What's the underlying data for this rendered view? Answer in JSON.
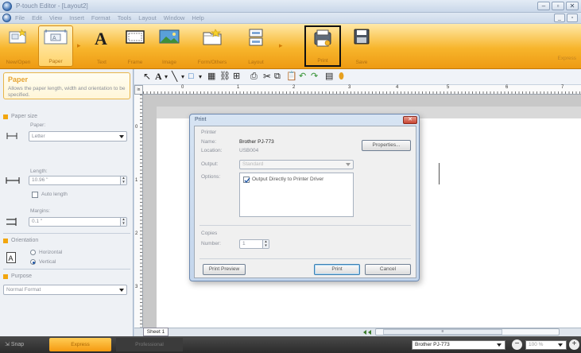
{
  "window": {
    "title": "P-touch Editor - [Layout2]",
    "controls": {
      "minimize": "–",
      "restore": "▫",
      "close": "✕"
    }
  },
  "menu": {
    "items": [
      "File",
      "Edit",
      "View",
      "Insert",
      "Format",
      "Tools",
      "Layout",
      "Window",
      "Help"
    ],
    "mdi_controls": {
      "minimize": "_",
      "restore": "▫"
    }
  },
  "ribbon": {
    "buttons": [
      {
        "label": "New/Open"
      },
      {
        "label": "Paper"
      },
      {
        "label": "Text"
      },
      {
        "label": "Frame"
      },
      {
        "label": "Image"
      },
      {
        "label": "Form/Others"
      },
      {
        "label": "Layout"
      },
      {
        "label": "Print"
      },
      {
        "label": "Save"
      }
    ],
    "right_label": "Express"
  },
  "left_panel": {
    "help_title": "Paper",
    "help_desc": "Allows the paper length, width and orientation to be specified.",
    "paper_size_title": "Paper size",
    "paper_label": "Paper:",
    "paper_value": "Letter",
    "length_label": "Length:",
    "length_value": "10.96 \"",
    "auto_length_label": "Auto length",
    "margins_label": "Margins:",
    "margins_value": "0.1 \"",
    "orientation_title": "Orientation",
    "horizontal_label": "Horizontal",
    "vertical_label": "Vertical",
    "purpose_title": "Purpose",
    "purpose_value": "Normal Format"
  },
  "ruler": {
    "unit": "in",
    "h_ticks": [
      "0",
      "1",
      "2",
      "3",
      "4",
      "5",
      "6",
      "7"
    ],
    "v_ticks": [
      "0",
      "1",
      "2",
      "3"
    ]
  },
  "dialog": {
    "title": "Print",
    "printer_group": "Printer",
    "name_label": "Name:",
    "name_value": "Brother PJ-773",
    "location_label": "Location:",
    "location_value": "USB004",
    "properties_button": "Properties...",
    "output_label": "Output:",
    "output_value": "Standard",
    "options_label": "Options:",
    "option_direct": "Output Directly to Printer Driver",
    "copies_group": "Copies",
    "number_label": "Number:",
    "number_value": "1",
    "print_preview_button": "Print Preview",
    "print_button": "Print",
    "cancel_button": "Cancel"
  },
  "sheet": {
    "tab": "Sheet 1"
  },
  "bottom": {
    "snap": "Snap",
    "express": "Express",
    "professional": "Professional",
    "printer": "Brother PJ-773",
    "zoom": "100 %"
  },
  "colors": {
    "ribbon_orange": "#f7b52c",
    "accent_yellow": "#f2a60e",
    "dialog_blue": "#c4d6ec",
    "highlight_box": "#111111"
  }
}
